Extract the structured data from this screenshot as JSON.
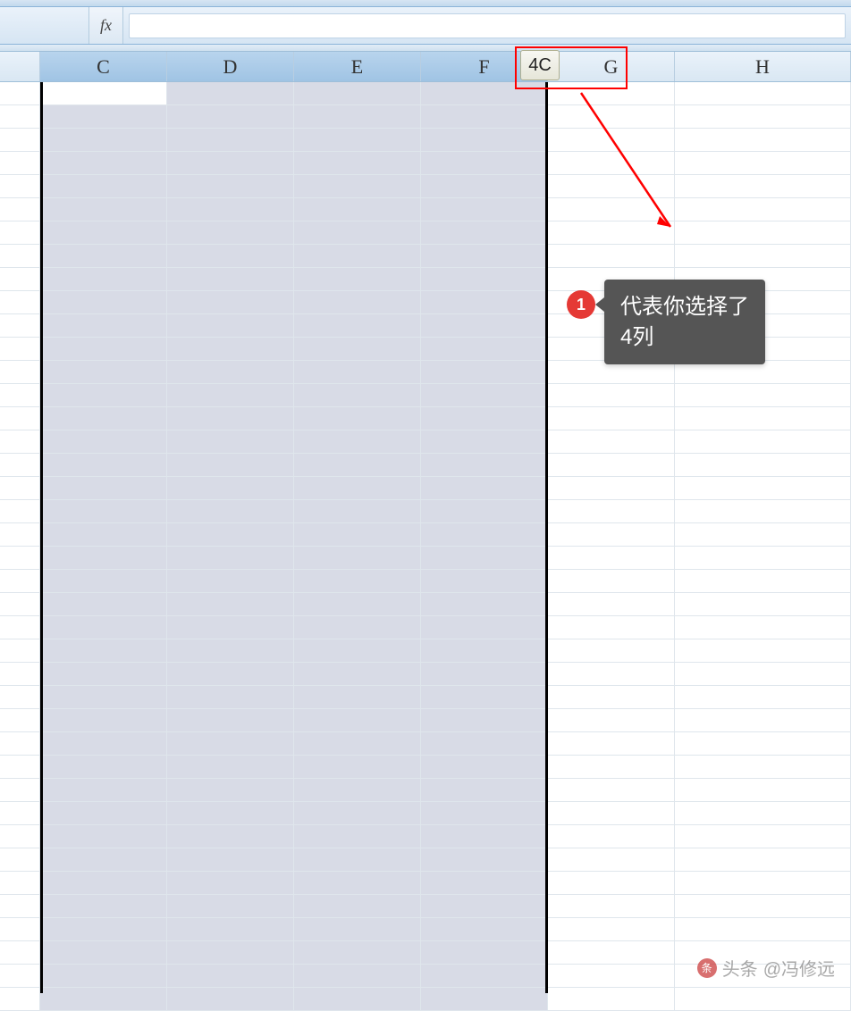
{
  "formula_bar": {
    "fx_label": "fx",
    "value": ""
  },
  "columns": [
    {
      "label": "",
      "width_class": "row-gutter-stub",
      "selected": false
    },
    {
      "label": "C",
      "width_class": "col-C",
      "selected": true
    },
    {
      "label": "D",
      "width_class": "col-D",
      "selected": true
    },
    {
      "label": "E",
      "width_class": "col-E",
      "selected": true
    },
    {
      "label": "F",
      "width_class": "col-F",
      "selected": true
    },
    {
      "label": "G",
      "width_class": "col-G",
      "selected": false
    },
    {
      "label": "H",
      "width_class": "col-H",
      "selected": false
    }
  ],
  "selection": {
    "tooltip": "4C"
  },
  "annotation": {
    "number": "1",
    "text": "代表你选择了4列"
  },
  "watermark": {
    "prefix": "头条",
    "handle": "@冯修远"
  },
  "row_count": 40,
  "colors": {
    "header_bg_light": "#eaf2fa",
    "header_bg_dark": "#d9e7f3",
    "selected_header": "#a0c4e4",
    "selection_fill": "#d8dbe6",
    "accent_red": "#ff0000",
    "callout_bg": "#555555",
    "badge_bg": "#e53935"
  }
}
